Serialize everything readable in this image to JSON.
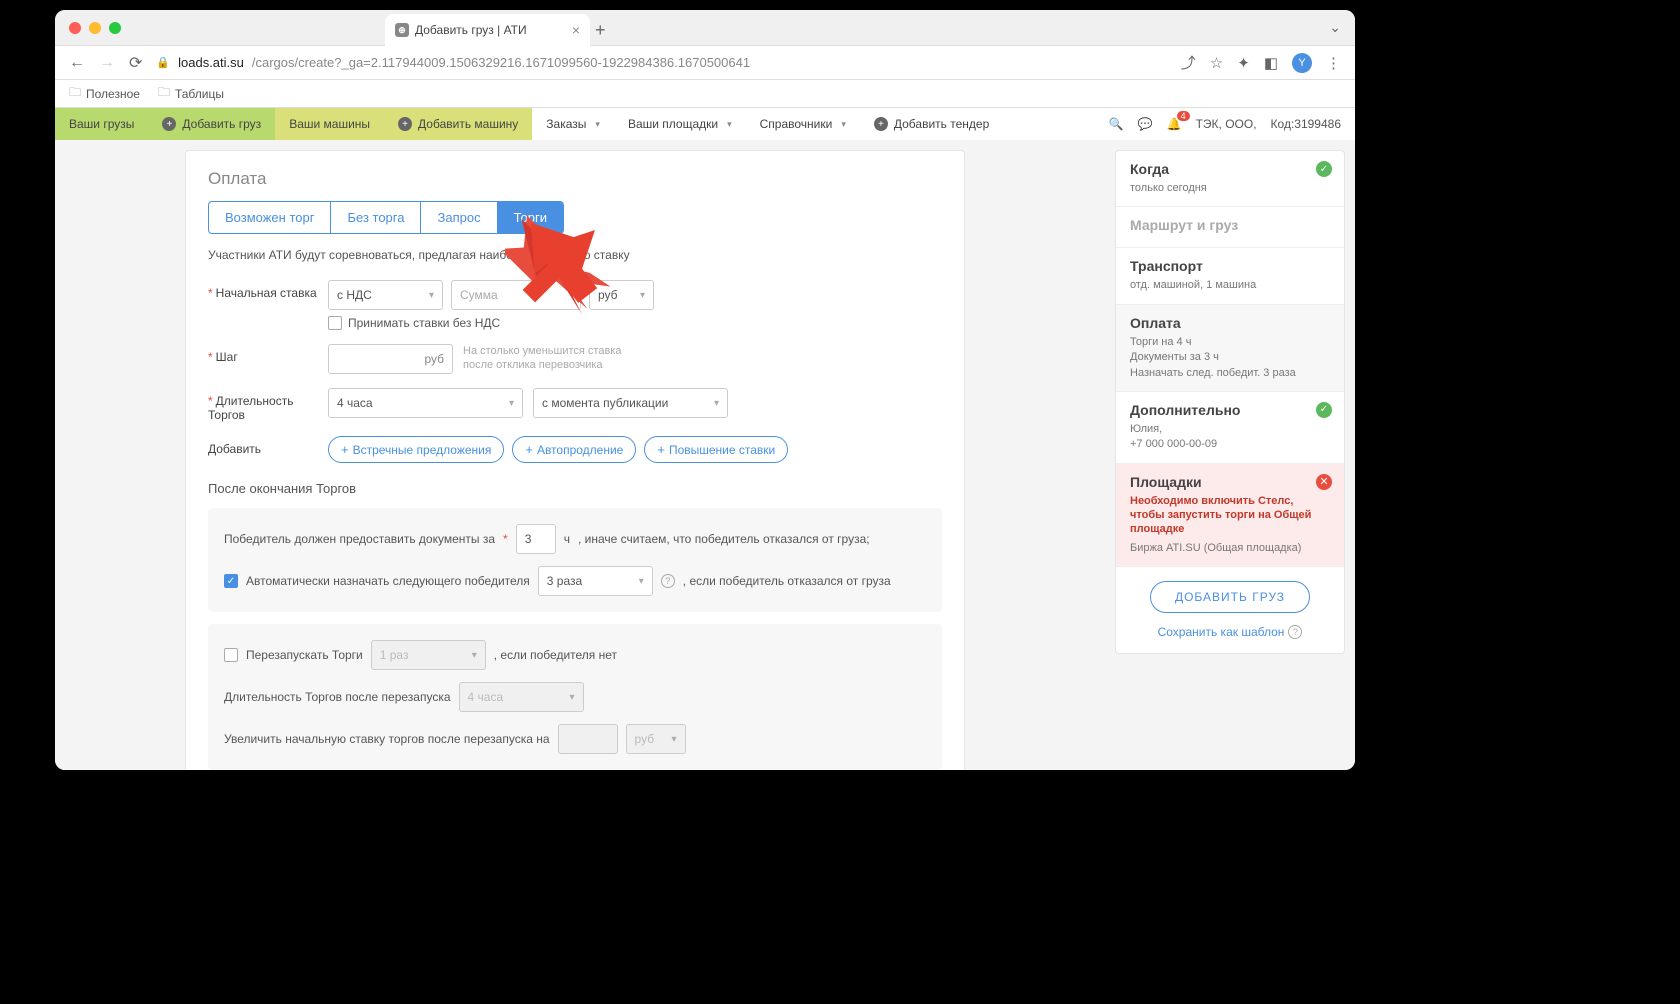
{
  "browser": {
    "tab_title": "Добавить груз | АТИ",
    "url_domain": "loads.ati.su",
    "url_path": "/cargos/create?_ga=2.117944009.1506329216.1671099560-1922984386.1670500641",
    "avatar": "Y",
    "bookmarks": [
      "Полезное",
      "Таблицы"
    ]
  },
  "toolbar": {
    "items": [
      "Ваши грузы",
      "Добавить груз",
      "Ваши машины",
      "Добавить машину",
      "Заказы",
      "Ваши площадки",
      "Справочники",
      "Добавить тендер"
    ],
    "org": "ТЭК, ООО,",
    "code": "Код:3199486",
    "notif_count": "4"
  },
  "payment": {
    "title": "Оплата",
    "tabs": [
      "Возможен торг",
      "Без торга",
      "Запрос",
      "Торги"
    ],
    "desc": "Участники АТИ будут соревноваться, предлагая наиболее выгодную ставку",
    "start_label": "Начальная ставка",
    "vat_sel": "с НДС",
    "sum_placeholder": "Сумма",
    "currency": "руб",
    "accept_no_vat": "Принимать ставки без НДС",
    "step_label": "Шаг",
    "step_unit": "руб",
    "step_hint": "На столько уменьшится ставка после отклика перевозчика",
    "dur_label": "Длительность Торгов",
    "dur_sel": "4 часа",
    "dur_from": "с момента публикации",
    "add_label": "Добавить",
    "chips": [
      "Встречные предложения",
      "Автопродление",
      "Повышение ставки"
    ]
  },
  "after": {
    "title": "После окончания Торгов",
    "winner_docs_pre": "Победитель должен предоставить документы за",
    "winner_docs_val": "3",
    "winner_docs_unit": "ч",
    "winner_docs_post": ", иначе считаем, что победитель отказался от груза;",
    "auto_next": "Автоматически назначать следующего победителя",
    "auto_next_sel": "3 раза",
    "auto_next_post": ", если победитель отказался от груза",
    "restart_chk": "Перезапускать Торги",
    "restart_sel": "1 раз",
    "restart_post": ", если победителя нет",
    "restart_dur_lbl": "Длительность Торгов после перезапуска",
    "restart_dur_sel": "4 часа",
    "increase_lbl": "Увеличить начальную ставку торгов после перезапуска на",
    "increase_cur": "руб"
  },
  "sidebar": {
    "when_h": "Когда",
    "when_t": "только сегодня",
    "route_h": "Маршрут и груз",
    "transport_h": "Транспорт",
    "transport_t": "отд. машиной, 1 машина",
    "pay_h": "Оплата",
    "pay_l1": "Торги на 4 ч",
    "pay_l2": "Документы за 3 ч",
    "pay_l3": "Назначать след. победит. 3 раза",
    "add_h": "Дополнительно",
    "add_name": "Юлия,",
    "add_phone": "+7 000 000-00-09",
    "plat_h": "Площадки",
    "plat_warn": "Необходимо включить Стелс, чтобы запустить торги на Общей площадке",
    "plat_t": "Биржа ATI.SU (Общая площадка)",
    "btn": "ДОБАВИТЬ ГРУЗ",
    "save_tpl": "Сохранить как шаблон"
  }
}
